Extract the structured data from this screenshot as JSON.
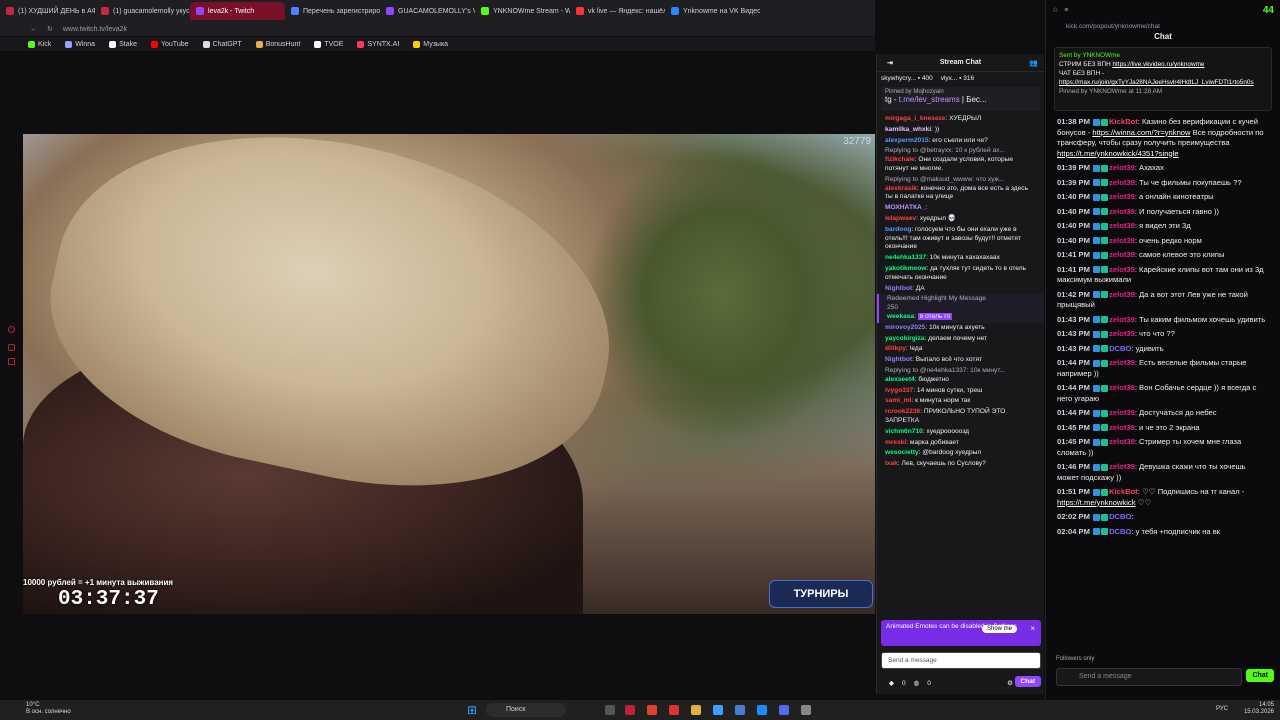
{
  "browser": {
    "tabs": [
      {
        "label": "(1) ХУДШИЙ ДЕНЬ в АФР",
        "color": "#cc2244",
        "active": false
      },
      {
        "label": "(1) guacamolemolly укус",
        "color": "#cc2244",
        "active": false
      },
      {
        "label": "leva2k - Twitch",
        "color": "#9147ff",
        "active": true
      },
      {
        "label": "Перечень зарегистриров",
        "color": "#5080ff",
        "active": false
      },
      {
        "label": "GUACAMOLEMOLLY's Vi",
        "color": "#9147ff",
        "active": false
      },
      {
        "label": "YNKNOWme Stream - Wi",
        "color": "#53fc18",
        "active": false
      },
      {
        "label": "vk live — Яндекс: нашёл",
        "color": "#ff3333",
        "active": false
      },
      {
        "label": "Ynknowme на VK Видео L",
        "color": "#2787f5",
        "active": false
      }
    ],
    "url": "www.twitch.tv/leva2k",
    "bookmarks": [
      {
        "label": "Kick",
        "color": "#53fc18"
      },
      {
        "label": "Winna",
        "color": "#8fa3ff"
      },
      {
        "label": "Stake",
        "color": "#ffffff"
      },
      {
        "label": "YouTube",
        "color": "#ff0000"
      },
      {
        "label": "ChatGPT",
        "color": "#dddddd"
      },
      {
        "label": "BonusHunt",
        "color": "#e0b050"
      },
      {
        "label": "TVOE",
        "color": "#ffffff"
      },
      {
        "label": "SYNTX.AI",
        "color": "#ff3366"
      },
      {
        "label": "Музыка",
        "color": "#ffcc00"
      }
    ]
  },
  "video": {
    "viewer_count": "32779",
    "timer_label": "10000 рублей = +1 минута выживания",
    "timer": "03:37:37",
    "tournament_label": "ТУРНИРЫ"
  },
  "twitch_chat": {
    "title": "Stream Chat",
    "leaders": [
      {
        "name": "skywhycry...",
        "count": "400"
      },
      {
        "name": "vlyx...",
        "count": "316"
      }
    ],
    "pinned_by": "Pinned by Mojhozyain",
    "pinned_text_prefix": "tg - ",
    "pinned_link": "t.me/lev_streams",
    "pinned_suffix": " | Бес...",
    "messages": [
      {
        "user": "mirgaga_i_kneseze",
        "color": "#ff4040",
        "text": ": ХУЕДРЫЛ",
        "reply": ""
      },
      {
        "user": "kamilka_whxki",
        "color": "#e0c0ff",
        "text": ": ))",
        "reply": ""
      },
      {
        "user": "alexperm2015",
        "color": "#5b99ff",
        "text": ": его съели или че?",
        "reply": ""
      },
      {
        "user": "fizikchale",
        "color": "#ff4040",
        "text": ": Они создали условия, которые потянут не многие.",
        "reply": "Replying to @betrayxx: 10 к рублей ах..."
      },
      {
        "user": "alexkrasik",
        "color": "#ff4040",
        "text": ": конечно это, дома все есть а здесь ты в палатке на улице",
        "reply": "Replying to @maksud_wwww: что хуж..."
      },
      {
        "user": "МОХНАТКА_",
        "color": "#bf94ff",
        "text": ":",
        "reply": ""
      },
      {
        "user": "lelapwaev",
        "color": "#ff4040",
        "text": ": хуедрыл 💀",
        "reply": ""
      },
      {
        "user": "bardoog",
        "color": "#5b99ff",
        "text": ": голосуем что бы они ехали уже в отель!!! там оживут и завозы будут!! отметят окончание",
        "reply": ""
      },
      {
        "user": "ne4ehka1337",
        "color": "#00ff7f",
        "text": ": 10к минута хахахахаах",
        "reply": ""
      },
      {
        "user": "yakotikmeow",
        "color": "#00ff7f",
        "text": ": да тухляк тут сидеть то в отель отмечать окончание",
        "reply": ""
      },
      {
        "user": "Nightbot",
        "color": "#8a85ff",
        "text": ": ДА",
        "reply": ""
      }
    ],
    "highlight_label": "Redeemed Highlight My Message",
    "highlight_cost": "250",
    "highlight_user": "weekasa",
    "highlight_text": "в отель го",
    "messages2": [
      {
        "user": "mirovoy2025",
        "color": "#8a85ff",
        "text": ": 10к минута ахуеть",
        "reply": ""
      },
      {
        "user": "yaycokirgiza",
        "color": "#00ff7f",
        "text": ": делаем почему нет",
        "reply": ""
      },
      {
        "user": "dilikpy",
        "color": "#ff4040",
        "text": ": !еда",
        "reply": ""
      },
      {
        "user": "Nightbot",
        "color": "#8a85ff",
        "text": ": Выпало всё что хотят",
        "reply": ""
      },
      {
        "user": "alexseet4",
        "color": "#00ff7f",
        "text": ": бюджетно",
        "reply": "Replying to @ne4ehka1337: 10к минут..."
      },
      {
        "user": "ivygo337",
        "color": "#ff4040",
        "text": ": 14 минов сутки, треш",
        "reply": ""
      },
      {
        "user": "sami_ml",
        "color": "#ff4040",
        "text": ": к минута норм так",
        "reply": ""
      },
      {
        "user": "rcrook2236",
        "color": "#ff4040",
        "text": ": ПРИКОЛЬНО ТУПОЙ ЭТО ЗАПРЕТКА",
        "reply": ""
      },
      {
        "user": "vichm6n710",
        "color": "#00ff7f",
        "text": ": хуедрооооозд",
        "reply": ""
      },
      {
        "user": "mreski",
        "color": "#ff4040",
        "text": ": марка добивает",
        "reply": ""
      },
      {
        "user": "wesocietty",
        "color": "#00ff7f",
        "text": ": @bardoog хуедрыл",
        "reply": ""
      },
      {
        "user": "Ixak",
        "color": "#ff4040",
        "text": ": Лев, скучаешь по Суслову?",
        "reply": ""
      }
    ],
    "notice_text": "Animated Emotes can be disabled in Settings",
    "notice_button": "Show me",
    "input_placeholder": "Send a message",
    "bits": "0",
    "points": "0",
    "chat_button": "Chat"
  },
  "kick": {
    "url": "kick.com/popout/ynknowme/chat",
    "title": "Chat",
    "pinned": {
      "sent_by": "Sent by YNKNOWme",
      "line1": "СТРИМ БЕЗ ВПН",
      "link1": "https://live.vkvideo.ru/ynknowme",
      "line2": "ЧАТ БЕЗ ВПН -",
      "link2": "https://max.ru/join/gxTyYJa28NAJeeHsvlr4lHdtLJ_LviwFDTt1rto5n0s",
      "pinned_by": "Pinned by YNKNOWme at 11:28 AM"
    },
    "messages": [
      {
        "time": "01:38 PM",
        "user": "KickBot",
        "text": ": Казино без верификации с кучей бонусов - ",
        "link": "https://winna.com/?r=ynknow",
        "text2": " Все подробности по трансферу, чтобы сразу получить преимущества ",
        "link2": "https://t.me/ynknowkick/4351?single"
      },
      {
        "time": "01:39 PM",
        "user": "zelot39",
        "text": ": Ахахах",
        "link": "",
        "text2": "",
        "link2": ""
      },
      {
        "time": "01:39 PM",
        "user": "zelot39",
        "text": ": Ты че фильмы покупаешь ??",
        "link": "",
        "text2": "",
        "link2": ""
      },
      {
        "time": "01:40 PM",
        "user": "zelot39",
        "text": ": а онлайн кинотеатры",
        "link": "",
        "text2": "",
        "link2": ""
      },
      {
        "time": "01:40 PM",
        "user": "zelot39",
        "text": ": И получаеться гавно ))",
        "link": "",
        "text2": "",
        "link2": ""
      },
      {
        "time": "01:40 PM",
        "user": "zelot39",
        "text": ": я видел эти 3д",
        "link": "",
        "text2": "",
        "link2": ""
      },
      {
        "time": "01:40 PM",
        "user": "zelot39",
        "text": ": очень редко норм",
        "link": "",
        "text2": "",
        "link2": ""
      },
      {
        "time": "01:41 PM",
        "user": "zelot39",
        "text": ": самое клевое это клипы",
        "link": "",
        "text2": "",
        "link2": ""
      },
      {
        "time": "01:41 PM",
        "user": "zelot39",
        "text": ": Карейские клипы вот там они из 3д максимум выжимали",
        "link": "",
        "text2": "",
        "link2": ""
      },
      {
        "time": "01:42 PM",
        "user": "zelot39",
        "text": ": Да а вот этот Лев уже не такой прыщявый",
        "link": "",
        "text2": "",
        "link2": ""
      },
      {
        "time": "01:43 PM",
        "user": "zelot39",
        "text": ": Ты каким фильмом хочешь удивить",
        "link": "",
        "text2": "",
        "link2": ""
      },
      {
        "time": "01:43 PM",
        "user": "zelot39",
        "text": ": что что ??",
        "link": "",
        "text2": "",
        "link2": ""
      },
      {
        "time": "01:43 PM",
        "user": "DCBO",
        "text": ": удивить",
        "link": "",
        "text2": "",
        "link2": ""
      },
      {
        "time": "01:44 PM",
        "user": "zelot39",
        "text": ": Есть веселые фильмы старые например ))",
        "link": "",
        "text2": "",
        "link2": ""
      },
      {
        "time": "01:44 PM",
        "user": "zelot39",
        "text": ": Вон Собачье сердце )) я всегда с него угараю",
        "link": "",
        "text2": "",
        "link2": ""
      },
      {
        "time": "01:44 PM",
        "user": "zelot39",
        "text": ": Достучаться до небес",
        "link": "",
        "text2": "",
        "link2": ""
      },
      {
        "time": "01:45 PM",
        "user": "zelot39",
        "text": ": и че это 2 экрана",
        "link": "",
        "text2": "",
        "link2": ""
      },
      {
        "time": "01:45 PM",
        "user": "zelot39",
        "text": ": Стример ты хочем мне глаза сломать ))",
        "link": "",
        "text2": "",
        "link2": ""
      },
      {
        "time": "01:46 PM",
        "user": "zelot39",
        "text": ": Девушка скажи что ты хочешь может подскажу ))",
        "link": "",
        "text2": "",
        "link2": ""
      },
      {
        "time": "01:51 PM",
        "user": "KickBot",
        "text": ": ♡♡ Подпишись на тг канал - ",
        "link": "https://t.me/ynknowkick",
        "text2": " ♡♡",
        "link2": ""
      },
      {
        "time": "02:02 PM",
        "user": "DCBO",
        "text": ":",
        "link": "",
        "text2": "",
        "link2": ""
      },
      {
        "time": "02:04 PM",
        "user": "DCBO",
        "text": ": у тебя +подписчик на вк",
        "link": "",
        "text2": "",
        "link2": ""
      }
    ],
    "followers_only": "Followers only",
    "input_placeholder": "Send a message",
    "chat_button": "Chat",
    "counter": "44"
  },
  "taskbar": {
    "weather_temp": "10°C",
    "weather_desc": "В осн. солнечно",
    "search": "Поиск",
    "lang": "РУС",
    "time": "14:05",
    "date": "15.03.2026"
  }
}
